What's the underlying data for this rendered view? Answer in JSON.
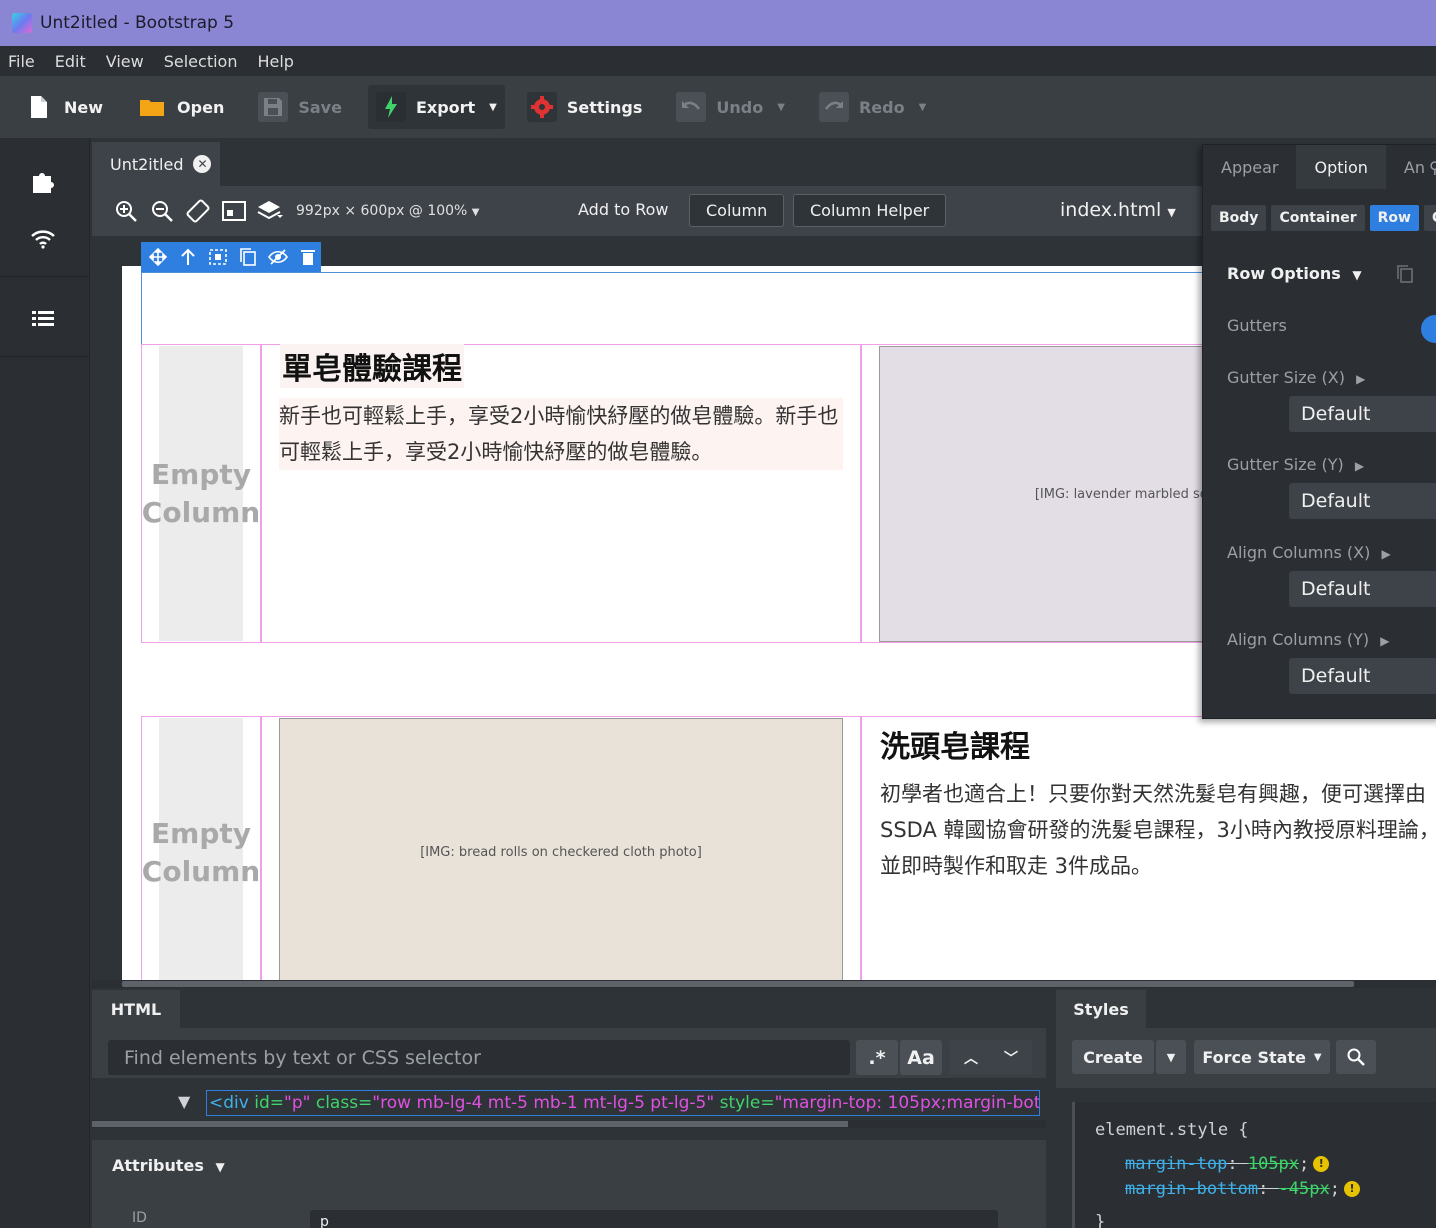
{
  "window": {
    "title": "Unt2itled - Bootstrap 5"
  },
  "menu": [
    "File",
    "Edit",
    "View",
    "Selection",
    "Help"
  ],
  "toolbar": {
    "new": "New",
    "open": "Open",
    "save": "Save",
    "export": "Export",
    "settings": "Settings",
    "undo": "Undo",
    "redo": "Redo"
  },
  "document_tab": {
    "label": "Unt2itled"
  },
  "canvas_bar": {
    "size": "992px × 600px @ 100%",
    "add_to_row": "Add to Row",
    "column": "Column",
    "column_helper": "Column Helper",
    "file": "index.html"
  },
  "canvas": {
    "empty_column": "Empty Column",
    "section1": {
      "title": "單皂體驗課程",
      "body": "新手也可輕鬆上手，享受2小時愉快紓壓的做皂體驗。新手也可輕鬆上手，享受2小時愉快紓壓的做皂體驗。"
    },
    "section2": {
      "title": "洗頭皂課程",
      "body": "初學者也適合上！只要你對天然洗髮皂有興趣，便可選擇由 SSDA 韓國協會研發的洗髮皂課程，3小時內教授原料理論，並即時製作和取走 3件成品。"
    },
    "image1_alt": "lavender marbled soap bars photo",
    "image2_alt": "bread rolls on checkered cloth photo"
  },
  "options_panel": {
    "tabs": [
      "Appear",
      "Option",
      "An"
    ],
    "active_tab": "Option",
    "breadcrumbs": [
      "Body",
      "Container",
      "Row",
      "Co"
    ],
    "active_crumb": "Row",
    "section": "Row Options",
    "gutters_label": "Gutters",
    "gutters_on": true,
    "fields": [
      {
        "label": "Gutter Size (X)",
        "value": "Default"
      },
      {
        "label": "Gutter Size (Y)",
        "value": "Default"
      },
      {
        "label": "Align Columns (X)",
        "value": "Default"
      },
      {
        "label": "Align Columns (Y)",
        "value": "Default"
      }
    ]
  },
  "html_panel": {
    "tab": "HTML",
    "search_placeholder": "Find elements by text or CSS selector",
    "regex_btn": ".*",
    "case_btn": "Aa",
    "node": {
      "tag_open": "<div",
      "id_attr": "id=",
      "id_val": "\"p\"",
      "class_attr": "class=",
      "class_val": "\"row mb-lg-4 mt-5 mb-1 mt-lg-5 pt-lg-5\"",
      "style_attr": "style=",
      "style_val": "\"margin-top: 105px;margin-bot"
    },
    "attributes_label": "Attributes",
    "id_label": "ID",
    "id_value": "p"
  },
  "styles_panel": {
    "tab": "Styles",
    "create": "Create",
    "force_state": "Force State",
    "selector": "element.style {",
    "rules": [
      {
        "prop": "margin-top",
        "value": "105px"
      },
      {
        "prop": "margin-bottom",
        "value": "-45px"
      }
    ],
    "close": "}"
  },
  "colors": {
    "accent": "#2f7fe0",
    "titlebar": "#8b86d4",
    "column_outline": "#f0a0e8",
    "code_attr": "#3fd46a",
    "code_val": "#e050e0",
    "code_tag": "#3fb0e8"
  }
}
